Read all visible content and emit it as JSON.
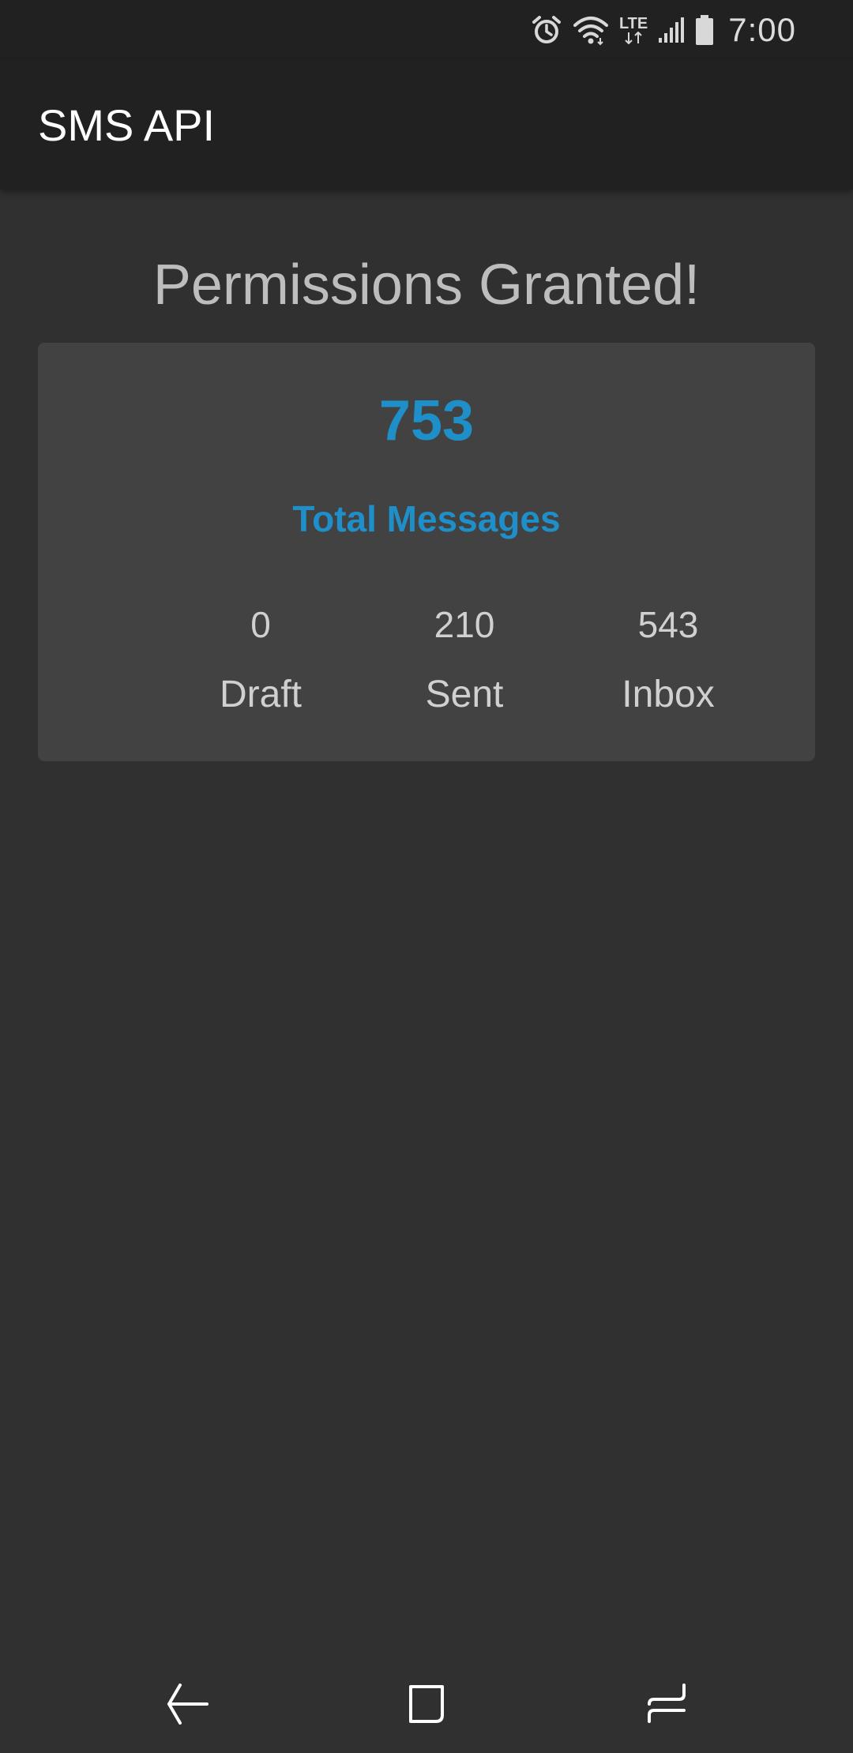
{
  "status_bar": {
    "time": "7:00",
    "icons": [
      "alarm-icon",
      "wifi-icon",
      "lte-icon",
      "signal-icon",
      "battery-icon"
    ],
    "lte_label": "LTE"
  },
  "app_bar": {
    "title": "SMS API"
  },
  "main": {
    "heading": "Permissions Granted!",
    "total": {
      "count": "753",
      "label": "Total Messages"
    },
    "stats": [
      {
        "value": "0",
        "label": "Draft"
      },
      {
        "value": "210",
        "label": "Sent"
      },
      {
        "value": "543",
        "label": "Inbox"
      }
    ]
  },
  "nav_bar": {
    "icons": [
      "back-icon",
      "home-icon",
      "recents-icon"
    ]
  },
  "colors": {
    "accent": "#1e8fc8",
    "background": "#303030",
    "app_bar": "#212121",
    "card": "#424242"
  }
}
